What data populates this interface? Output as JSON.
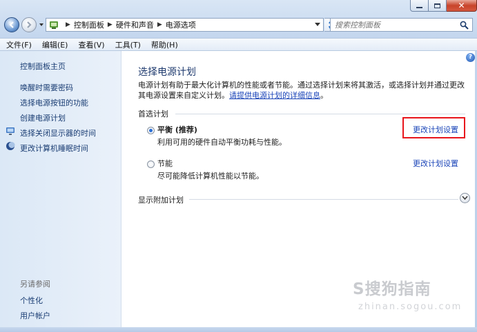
{
  "window": {
    "title_controls": [
      "minimize",
      "maximize",
      "close"
    ]
  },
  "nav": {
    "breadcrumbs": [
      "控制面板",
      "硬件和声音",
      "电源选项"
    ],
    "search_placeholder": "搜索控制面板"
  },
  "menu": [
    "文件(F)",
    "编辑(E)",
    "查看(V)",
    "工具(T)",
    "帮助(H)"
  ],
  "sidebar": {
    "home": "控制面板主页",
    "items": [
      {
        "label": "唤醒时需要密码",
        "icon": ""
      },
      {
        "label": "选择电源按钮的功能",
        "icon": ""
      },
      {
        "label": "创建电源计划",
        "icon": ""
      },
      {
        "label": "选择关闭显示器的时间",
        "icon": "monitor-icon"
      },
      {
        "label": "更改计算机睡眠时间",
        "icon": "moon-icon"
      }
    ],
    "see_also": "另请参阅",
    "see_also_items": [
      "个性化",
      "用户帐户"
    ]
  },
  "main": {
    "title": "选择电源计划",
    "description_text": "电源计划有助于最大化计算机的性能或者节能。通过选择计划来将其激活，或选择计划并通过更改其电源设置来自定义计划。",
    "description_link": "请提供电源计划的详细信息",
    "description_end": "。",
    "preferred_title": "首选计划",
    "plans": [
      {
        "name": "平衡 (推荐)",
        "description": "利用可用的硬件自动平衡功耗与性能。",
        "link": "更改计划设置",
        "selected": true
      },
      {
        "name": "节能",
        "description": "尽可能降低计算机性能以节能。",
        "link": "更改计划设置",
        "selected": false
      }
    ],
    "additional_title": "显示附加计划"
  },
  "watermark": {
    "logo": "S搜狗指南",
    "url": "zhinan.sogou.com"
  },
  "colors": {
    "link": "#1a44b8",
    "title": "#1e3a6e",
    "highlight": "#e8141b"
  }
}
